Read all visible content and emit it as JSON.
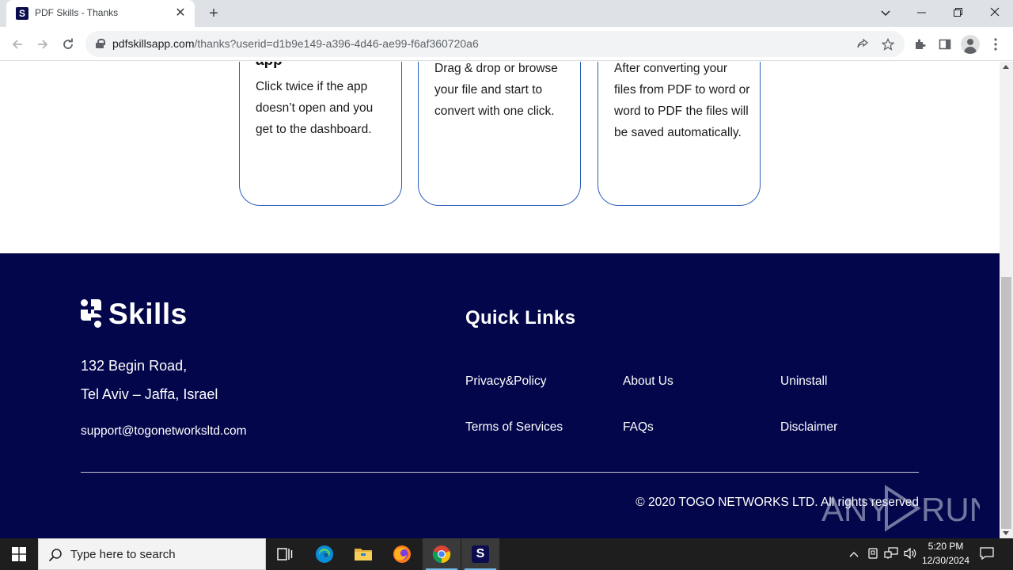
{
  "browser": {
    "tab_title": "PDF Skills - Thanks",
    "tab_favicon_letter": "S",
    "url_host": "pdfskillsapp.com",
    "url_path": "/thanks?userid=d1b9e149-a396-4d46-ae99-f6af360720a6"
  },
  "steps": [
    {
      "heading": "app",
      "text": "Click twice if the app doesn’t open and you get to the dashboard."
    },
    {
      "heading": "",
      "text": "Drag & drop or browse your file and start to convert with one click."
    },
    {
      "heading": "",
      "text": "After converting your files from PDF to word or word to PDF the files will be saved automatically."
    }
  ],
  "footer": {
    "logo_text": "Skills",
    "address_line1": "132 Begin Road,",
    "address_line2": "Tel Aviv – Jaffa, Israel",
    "email": "support@togonetworksltd.com",
    "quick_links_title": "Quick Links",
    "links": {
      "privacy": "Privacy&Policy",
      "about": "About Us",
      "uninstall": "Uninstall",
      "terms": "Terms of Services",
      "faqs": "FAQs",
      "disclaimer": "Disclaimer"
    },
    "copyright": "© 2020 TOGO NETWORKS LTD. All rights reserved",
    "watermark": "ANY RUN"
  },
  "taskbar": {
    "search_placeholder": "Type here to search",
    "time": "5:20 PM",
    "date": "12/30/2024"
  },
  "colors": {
    "footer_bg": "#03064a",
    "card_border": "#2a5dbb",
    "taskbar_bg": "#1e1e1e"
  }
}
